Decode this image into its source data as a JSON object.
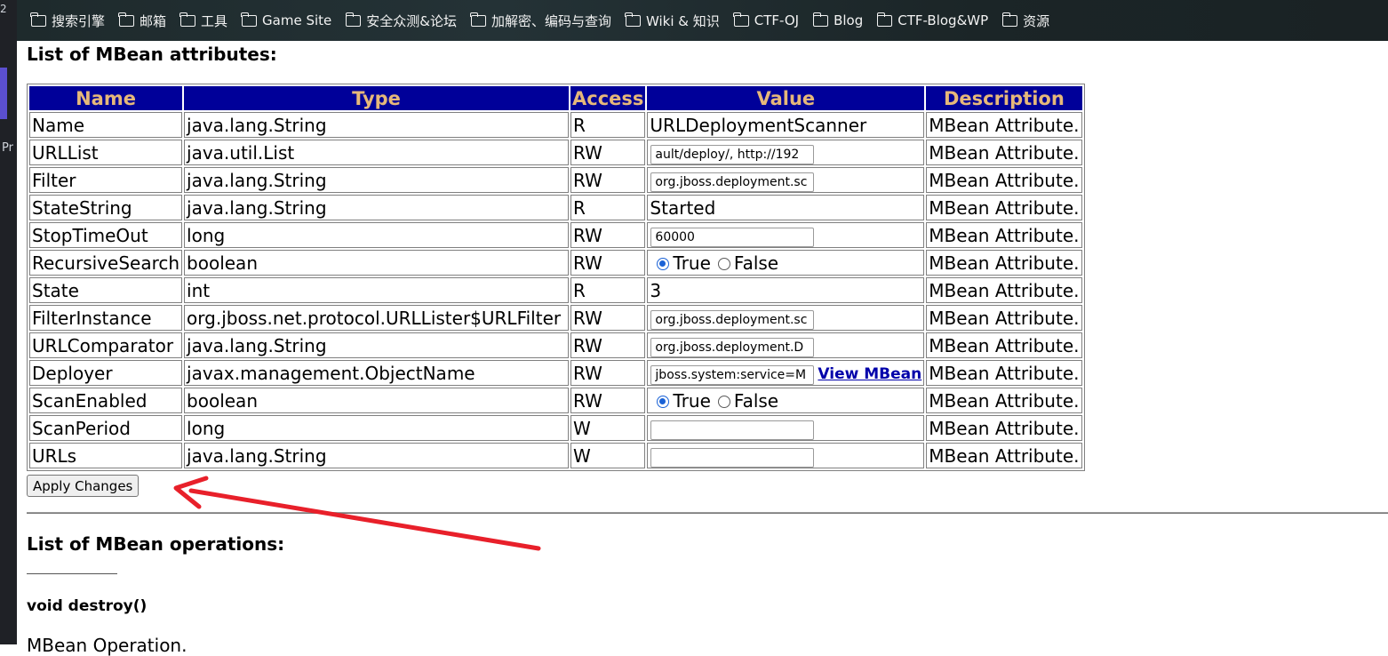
{
  "bookmarks": [
    {
      "label": "搜索引擎"
    },
    {
      "label": "邮箱"
    },
    {
      "label": "工具"
    },
    {
      "label": "Game Site"
    },
    {
      "label": "安全众测&论坛"
    },
    {
      "label": "加解密、编码与查询"
    },
    {
      "label": "Wiki & 知识"
    },
    {
      "label": "CTF-OJ"
    },
    {
      "label": "Blog"
    },
    {
      "label": "CTF-Blog&WP"
    },
    {
      "label": "资源"
    }
  ],
  "side": {
    "pr_text": "Pr",
    "tab_text": "2"
  },
  "attributes": {
    "heading": "List of MBean attributes:",
    "columns": {
      "name": "Name",
      "type": "Type",
      "access": "Access",
      "value": "Value",
      "description": "Description"
    },
    "rows": [
      {
        "name": "Name",
        "type": "java.lang.String",
        "access": "R",
        "value": "URLDeploymentScanner",
        "description": "MBean Attribute."
      },
      {
        "name": "URLList",
        "type": "java.util.List",
        "access": "RW",
        "value": "ault/deploy/, http://192",
        "description": "MBean Attribute."
      },
      {
        "name": "Filter",
        "type": "java.lang.String",
        "access": "RW",
        "value": "org.jboss.deployment.sc",
        "description": "MBean Attribute."
      },
      {
        "name": "StateString",
        "type": "java.lang.String",
        "access": "R",
        "value": "Started",
        "description": "MBean Attribute."
      },
      {
        "name": "StopTimeOut",
        "type": "long",
        "access": "RW",
        "value": "60000",
        "description": "MBean Attribute."
      },
      {
        "name": "RecursiveSearch",
        "type": "boolean",
        "access": "RW",
        "value": "",
        "true_label": "True",
        "false_label": "False",
        "selected": "True",
        "description": "MBean Attribute."
      },
      {
        "name": "State",
        "type": "int",
        "access": "R",
        "value": "3",
        "description": "MBean Attribute."
      },
      {
        "name": "FilterInstance",
        "type": "org.jboss.net.protocol.URLLister$URLFilter",
        "access": "RW",
        "value": "org.jboss.deployment.sc",
        "description": "MBean Attribute."
      },
      {
        "name": "URLComparator",
        "type": "java.lang.String",
        "access": "RW",
        "value": "org.jboss.deployment.D",
        "description": "MBean Attribute."
      },
      {
        "name": "Deployer",
        "type": "javax.management.ObjectName",
        "access": "RW",
        "value": "jboss.system:service=M",
        "link": "View MBean",
        "description": "MBean Attribute."
      },
      {
        "name": "ScanEnabled",
        "type": "boolean",
        "access": "RW",
        "value": "",
        "true_label": "True",
        "false_label": "False",
        "selected": "True",
        "description": "MBean Attribute."
      },
      {
        "name": "ScanPeriod",
        "type": "long",
        "access": "W",
        "value": "",
        "description": "MBean Attribute."
      },
      {
        "name": "URLs",
        "type": "java.lang.String",
        "access": "W",
        "value": "",
        "description": "MBean Attribute."
      }
    ],
    "apply_label": "Apply Changes"
  },
  "operations": {
    "heading": "List of MBean operations:",
    "first_op": "void destroy()",
    "first_op_desc": "MBean Operation."
  },
  "colors": {
    "header_bg": "#000099",
    "header_text": "#e6b87a",
    "annotation_arrow": "#e8202a",
    "link": "#0000aa"
  }
}
